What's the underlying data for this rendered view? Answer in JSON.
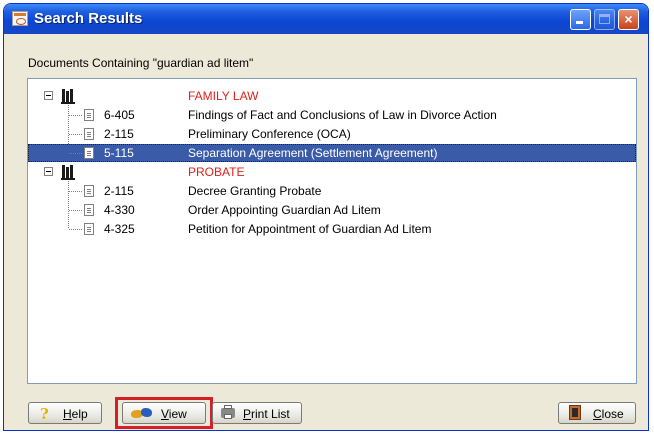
{
  "window": {
    "title": "Search Results",
    "minimize_glyph": "",
    "close_glyph": "×"
  },
  "heading": "Documents Containing \"guardian ad litem\"",
  "groups": [
    {
      "category": "FAMILY LAW",
      "items": [
        {
          "code": "6-405",
          "title": "Findings of Fact and Conclusions of Law in Divorce Action"
        },
        {
          "code": "2-115",
          "title": "Preliminary Conference (OCA)"
        },
        {
          "code": "5-115",
          "title": "Separation Agreement (Settlement Agreement)",
          "selected": true
        }
      ]
    },
    {
      "category": "PROBATE",
      "items": [
        {
          "code": "2-115",
          "title": "Decree Granting Probate"
        },
        {
          "code": "4-330",
          "title": "Order Appointing Guardian Ad Litem"
        },
        {
          "code": "4-325",
          "title": "Petition for Appointment of Guardian Ad Litem"
        }
      ]
    }
  ],
  "buttons": {
    "help": "Help",
    "view": "View",
    "print": "Print List",
    "close": "Close"
  },
  "colors": {
    "category_text": "#e0201c",
    "selection": "#3a5ba8",
    "highlight_box": "#d41f26"
  }
}
